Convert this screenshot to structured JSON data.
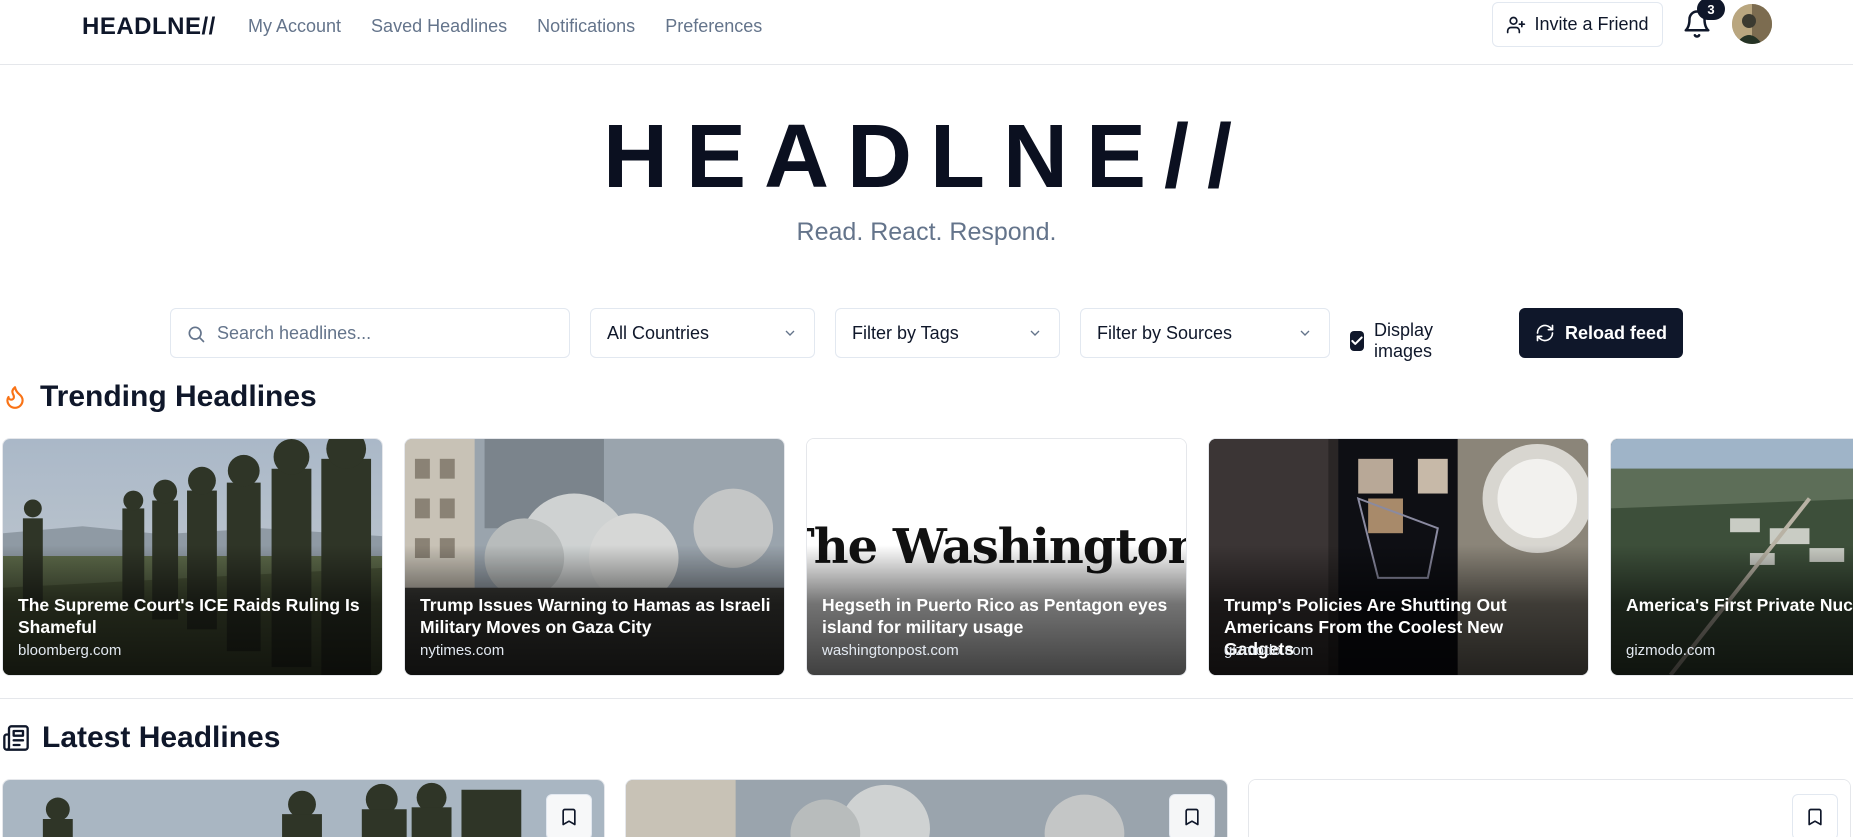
{
  "nav": {
    "brand": "HEADLNE//",
    "links": [
      "My Account",
      "Saved Headlines",
      "Notifications",
      "Preferences"
    ],
    "invite_label": "Invite a Friend",
    "notification_count": "3"
  },
  "hero": {
    "title": "HEADLNE//",
    "tagline": "Read. React. Respond."
  },
  "filters": {
    "search_placeholder": "Search headlines...",
    "countries": "All Countries",
    "tags": "Filter by Tags",
    "sources": "Filter by Sources",
    "display_images_label": "Display images",
    "display_images_checked": true,
    "reload_label": "Reload feed"
  },
  "trending": {
    "heading": "Trending Headlines",
    "icon": "flame-icon",
    "items": [
      {
        "title": "The Supreme Court's ICE Raids Ruling Is Shameful",
        "source": "bloomberg.com"
      },
      {
        "title": "Trump Issues Warning to Hamas as Israeli Military Moves on Gaza City",
        "source": "nytimes.com"
      },
      {
        "title": "Hegseth in Puerto Rico as Pentagon eyes island for military usage",
        "source": "washingtonpost.com",
        "image_text": "The Washington Post"
      },
      {
        "title": "Trump's Policies Are Shutting Out Americans From the Coolest New Gadgets",
        "source": "gizmodo.com"
      },
      {
        "title": "America's First Private Nuclear Recycling Facility to Open in",
        "source": "gizmodo.com"
      }
    ]
  },
  "latest": {
    "heading": "Latest Headlines",
    "icon": "newspaper-icon"
  },
  "colors": {
    "primary": "#0f172a",
    "muted": "#64748b",
    "border": "#e2e8f0",
    "flame": "#f97316"
  }
}
